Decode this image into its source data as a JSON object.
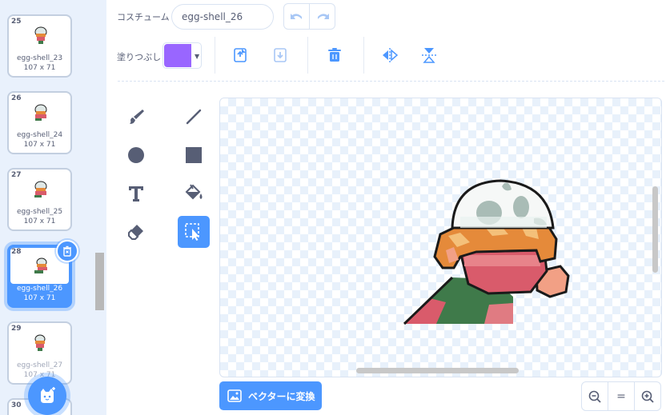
{
  "costumes": [
    {
      "num": "25",
      "name": "egg-shell_23",
      "size": "107 x 71"
    },
    {
      "num": "26",
      "name": "egg-shell_24",
      "size": "107 x 71"
    },
    {
      "num": "27",
      "name": "egg-shell_25",
      "size": "107 x 71"
    },
    {
      "num": "28",
      "name": "egg-shell_26",
      "size": "107 x 71"
    },
    {
      "num": "29",
      "name": "egg-shell_27",
      "size": "107 x 71"
    },
    {
      "num": "30"
    }
  ],
  "toolbar": {
    "costume_label": "コスチューム",
    "costume_name": "egg-shell_26",
    "fill_label": "塗りつぶし",
    "fill_color": "#9966ff"
  },
  "bottom": {
    "convert_label": "ベクターに変換",
    "zoom_reset": "="
  },
  "icons": {
    "undo": "undo-icon",
    "redo": "redo-icon",
    "forward": "forward-icon",
    "backward": "backward-icon",
    "delete": "trash-icon",
    "flip_h": "flip-horizontal-icon",
    "flip_v": "flip-vertical-icon",
    "brush": "brush-icon",
    "line": "line-icon",
    "circle": "circle-icon",
    "rect": "rectangle-icon",
    "text": "text-icon",
    "fill": "fill-bucket-icon",
    "eraser": "eraser-icon",
    "select": "select-icon",
    "zoom_out": "zoom-out-icon",
    "zoom_in": "zoom-in-icon",
    "choose": "choose-costume-icon"
  },
  "accent_color": "#4c97ff"
}
